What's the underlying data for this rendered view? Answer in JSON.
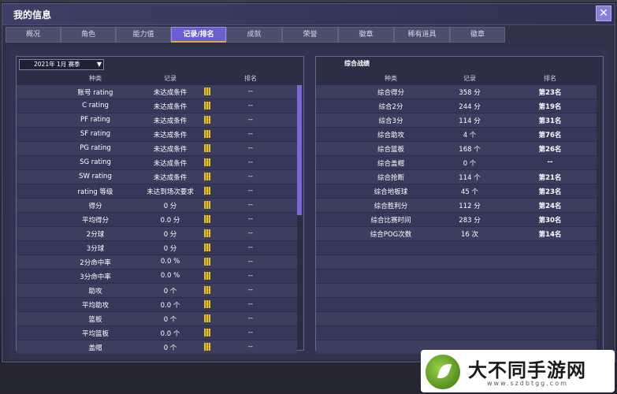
{
  "window": {
    "title": "我的信息",
    "close_label": "✕"
  },
  "tabs": [
    {
      "label": "概况"
    },
    {
      "label": "角色"
    },
    {
      "label": "能力值"
    },
    {
      "label": "记录/排名",
      "active": true
    },
    {
      "label": "成就"
    },
    {
      "label": "荣誉"
    },
    {
      "label": "徽章"
    },
    {
      "label": "稀有道具"
    },
    {
      "label": "徽章"
    }
  ],
  "left_panel": {
    "season_select": "2021年 1月 赛季",
    "headers": [
      "种类",
      "记录",
      "排名"
    ],
    "rows": [
      {
        "type": "账号 rating",
        "record": "未达成条件",
        "rank": "--"
      },
      {
        "type": "C rating",
        "record": "未达成条件",
        "rank": "--"
      },
      {
        "type": "PF rating",
        "record": "未达成条件",
        "rank": "--"
      },
      {
        "type": "SF rating",
        "record": "未达成条件",
        "rank": "--"
      },
      {
        "type": "PG rating",
        "record": "未达成条件",
        "rank": "--"
      },
      {
        "type": "SG rating",
        "record": "未达成条件",
        "rank": "--"
      },
      {
        "type": "SW rating",
        "record": "未达成条件",
        "rank": "--"
      },
      {
        "type": "rating 等级",
        "record": "未达到场次要求",
        "rank": "--"
      },
      {
        "type": "得分",
        "record": "0 分",
        "rank": "--"
      },
      {
        "type": "平均得分",
        "record": "0.0 分",
        "rank": "--"
      },
      {
        "type": "2分球",
        "record": "0 分",
        "rank": "--"
      },
      {
        "type": "3分球",
        "record": "0 分",
        "rank": "--"
      },
      {
        "type": "2分命中率",
        "record": "0.0 %",
        "rank": "--"
      },
      {
        "type": "3分命中率",
        "record": "0.0 %",
        "rank": "--"
      },
      {
        "type": "助攻",
        "record": "0 个",
        "rank": "--"
      },
      {
        "type": "平均助攻",
        "record": "0.0 个",
        "rank": "--"
      },
      {
        "type": "篮板",
        "record": "0 个",
        "rank": "--"
      },
      {
        "type": "平均篮板",
        "record": "0.0 个",
        "rank": "--"
      },
      {
        "type": "盖帽",
        "record": "0 个",
        "rank": "--"
      }
    ]
  },
  "right_panel": {
    "heading": "综合战绩",
    "headers": [
      "种类",
      "记录",
      "排名"
    ],
    "rows": [
      {
        "type": "综合得分",
        "record": "358 分",
        "rank": "第23名"
      },
      {
        "type": "综合2分",
        "record": "244 分",
        "rank": "第19名"
      },
      {
        "type": "综合3分",
        "record": "114 分",
        "rank": "第31名"
      },
      {
        "type": "综合助攻",
        "record": "4 个",
        "rank": "第76名"
      },
      {
        "type": "综合篮板",
        "record": "168 个",
        "rank": "第26名"
      },
      {
        "type": "综合盖帽",
        "record": "0 个",
        "rank": "--"
      },
      {
        "type": "综合抢断",
        "record": "114 个",
        "rank": "第21名"
      },
      {
        "type": "综合地板球",
        "record": "45 个",
        "rank": "第23名"
      },
      {
        "type": "综合胜利分",
        "record": "112 分",
        "rank": "第24名"
      },
      {
        "type": "综合比赛时间",
        "record": "283 分",
        "rank": "第30名"
      },
      {
        "type": "综合POG次数",
        "record": "16 次",
        "rank": "第14名"
      }
    ]
  },
  "scroll": {
    "position": 0
  },
  "watermark": {
    "title": "大不同手游网",
    "url": "www.szdbtgg.com"
  },
  "colors": {
    "accent": "#6a5fcf",
    "tab_underline": "#e3a743",
    "scroll_thumb": "#7a66d8"
  }
}
